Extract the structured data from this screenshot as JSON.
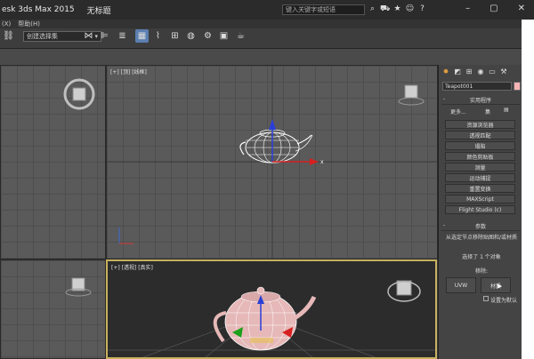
{
  "titlebar": {
    "app_title": "esk 3ds Max  2015",
    "doc_title": "无标题",
    "search_placeholder": "键入关键字或短语",
    "icons": [
      "binoculars-icon",
      "cart-icon",
      "star-icon",
      "user-icon",
      "help-icon"
    ],
    "window_controls": [
      "–",
      "▢",
      "✕"
    ]
  },
  "menubar": {
    "items": [
      "(X)",
      "帮助(H)"
    ]
  },
  "toolbar": {
    "selection_sets": "创建选择集"
  },
  "viewports": {
    "top_label": "[+] [顶] [线框]",
    "persp_label": "[+] [透视] [真实]"
  },
  "command_panel": {
    "object_name": "Teapot001",
    "object_color": "#f7b4b6",
    "utilities_header": "实用程序",
    "more_label": "更多...",
    "sets_label": "集",
    "utility_buttons": [
      "资源浏览器",
      "透视匹配",
      "塌陷",
      "颜色剪贴板",
      "测量",
      "运动捕捉",
      "重置变换",
      "MAXScript",
      "Flight Studio (c)"
    ],
    "params_header": "参数",
    "description": "从选定节点移除贴图和/或材质",
    "selected_count": "选择了 1 个对象",
    "remove_label": "移除:",
    "uvw_label": "UVW",
    "material_label": "材质",
    "set_default_label": "设置为默认"
  }
}
